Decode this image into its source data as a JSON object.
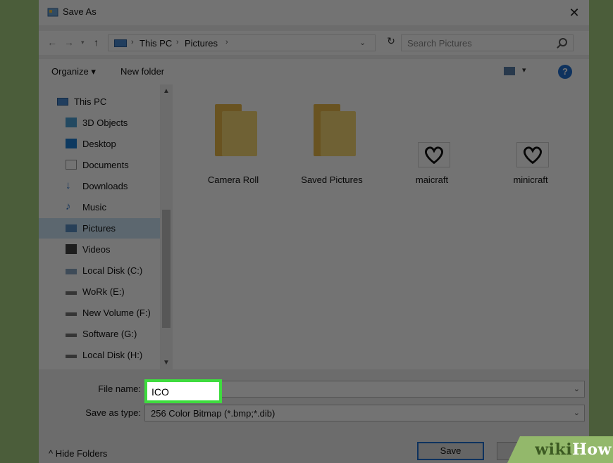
{
  "window": {
    "title": "Save As"
  },
  "address": {
    "crumbs": [
      "This PC",
      "Pictures"
    ],
    "search_placeholder": "Search Pictures"
  },
  "toolbar": {
    "organize": "Organize ▾",
    "new_folder": "New folder",
    "help": "?"
  },
  "nav": {
    "items": [
      {
        "label": "This PC",
        "icon": "computer-icon"
      },
      {
        "label": "3D Objects",
        "icon": "cube-icon"
      },
      {
        "label": "Desktop",
        "icon": "desktop-icon"
      },
      {
        "label": "Documents",
        "icon": "document-icon"
      },
      {
        "label": "Downloads",
        "icon": "download-icon"
      },
      {
        "label": "Music",
        "icon": "music-icon"
      },
      {
        "label": "Pictures",
        "icon": "pictures-icon",
        "selected": true
      },
      {
        "label": "Videos",
        "icon": "video-icon"
      },
      {
        "label": "Local Disk (C:)",
        "icon": "disk-icon"
      },
      {
        "label": "WoRk (E:)",
        "icon": "drive-icon"
      },
      {
        "label": "New Volume (F:)",
        "icon": "drive-icon"
      },
      {
        "label": "Software (G:)",
        "icon": "drive-icon"
      },
      {
        "label": "Local Disk (H:)",
        "icon": "drive-icon"
      }
    ]
  },
  "files": [
    {
      "label": "Camera Roll",
      "type": "folder"
    },
    {
      "label": "Saved Pictures",
      "type": "folder"
    },
    {
      "label": "maicraft",
      "type": "image"
    },
    {
      "label": "minicraft",
      "type": "image"
    }
  ],
  "form": {
    "file_name_label": "File name:",
    "file_name_value": "ICO",
    "save_type_label": "Save as type:",
    "save_type_value": "256 Color Bitmap (*.bmp;*.dib)",
    "hide_folders": "^ Hide Folders",
    "save_button": "Save"
  },
  "watermark": {
    "wiki": "wiki",
    "how": "How"
  },
  "colors": {
    "highlight": "#3edc3e",
    "accent": "#1f6fd1",
    "background": "#4b5d3a"
  }
}
